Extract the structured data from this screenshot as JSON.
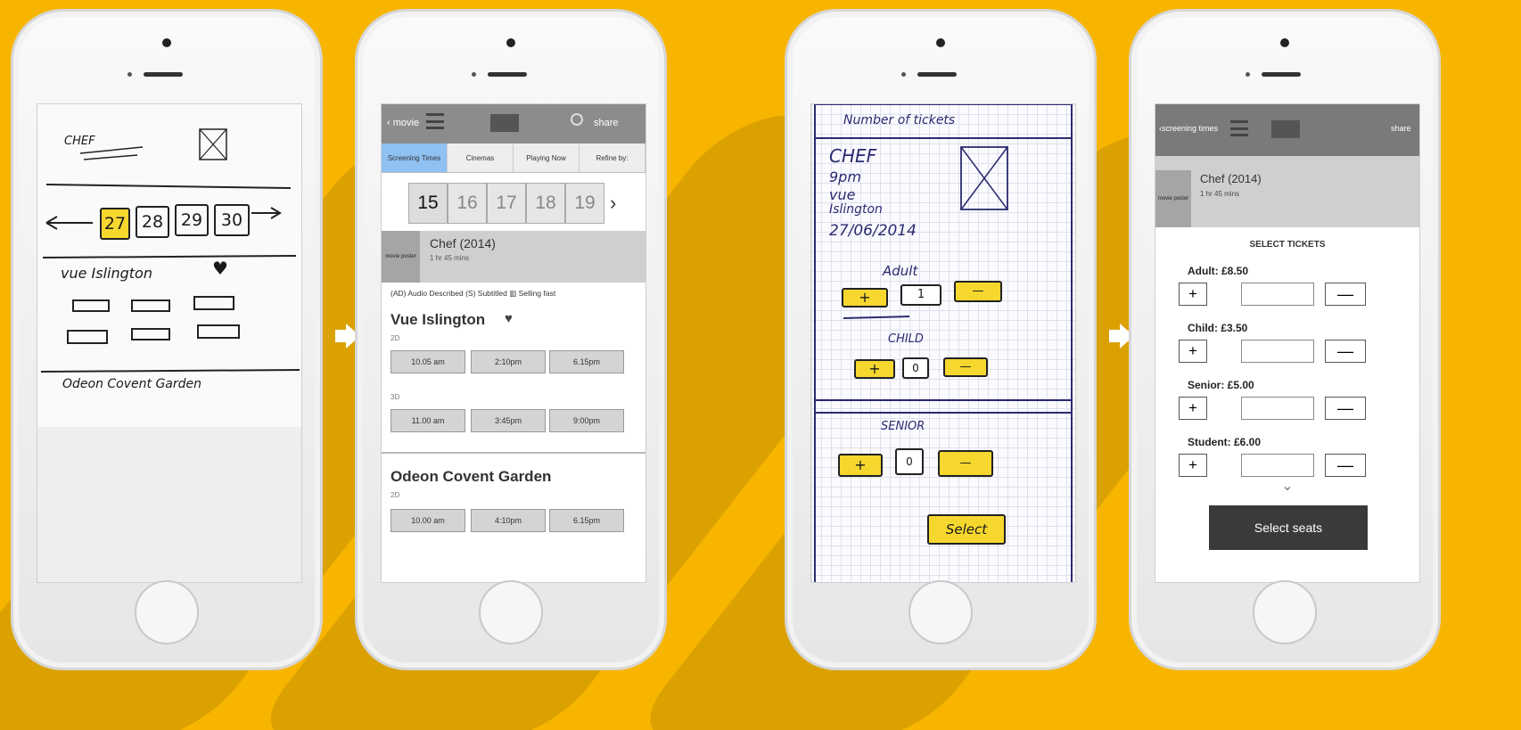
{
  "colors": {
    "background": "#f7b500",
    "shadow": "#dba100",
    "highlight": "#f6d72e",
    "active_tab": "#8fc1f2"
  },
  "sketch1": {
    "title": "CHEF",
    "dates": [
      "27",
      "28",
      "29",
      "30"
    ],
    "cinema": "vue Islington",
    "second_cinema": "Odeon Covent Garden"
  },
  "wireframe2": {
    "back_label": "‹ movie",
    "share_label": "share",
    "tabs": [
      "Screening Times",
      "Cinemas",
      "Playing Now",
      "Refine by:"
    ],
    "dates": [
      "15",
      "16",
      "17",
      "18",
      "19"
    ],
    "next_icon": "›",
    "poster_label": "movie poster",
    "movie_title": "Chef (2014)",
    "movie_duration": "1 hr 45 mins",
    "legend": "(AD) Audio Described   (S) Subtitled   ▥ Selling fast",
    "cinema1": {
      "name": "Vue Islington",
      "format1": "2D",
      "times1": [
        "10.05 am",
        "2:10pm",
        "6.15pm"
      ],
      "format2": "3D",
      "times2": [
        "11.00 am",
        "3:45pm",
        "9:00pm"
      ]
    },
    "cinema2": {
      "name": "Odeon Covent Garden",
      "format1": "2D",
      "times1": [
        "10.00 am",
        "4:10pm",
        "6.15pm"
      ]
    }
  },
  "sketch3": {
    "header": "Number of tickets",
    "movie": "CHEF",
    "time": "9pm",
    "venue1": "vue",
    "venue2": "Islington",
    "date": "27/06/2014",
    "adult_label": "Adult",
    "adult_count": "1",
    "child_label": "CHILD",
    "child_count": "0",
    "senior_label": "SENIOR",
    "senior_count": "0",
    "plus": "+",
    "minus": "—",
    "select_label": "Select"
  },
  "wireframe4": {
    "back_label": "‹screening times",
    "share_label": "share",
    "poster_label": "movie poster",
    "movie_title": "Chef (2014)",
    "movie_duration": "1 hr 45 mins",
    "section_title": "SELECT TICKETS",
    "tickets": [
      {
        "label": "Adult:  £8.50"
      },
      {
        "label": "Child:  £3.50"
      },
      {
        "label": "Senior: £5.00"
      },
      {
        "label": "Student: £6.00"
      }
    ],
    "plus": "+",
    "minus": "—",
    "more_icon": "⌄",
    "cta_label": "Select seats"
  }
}
